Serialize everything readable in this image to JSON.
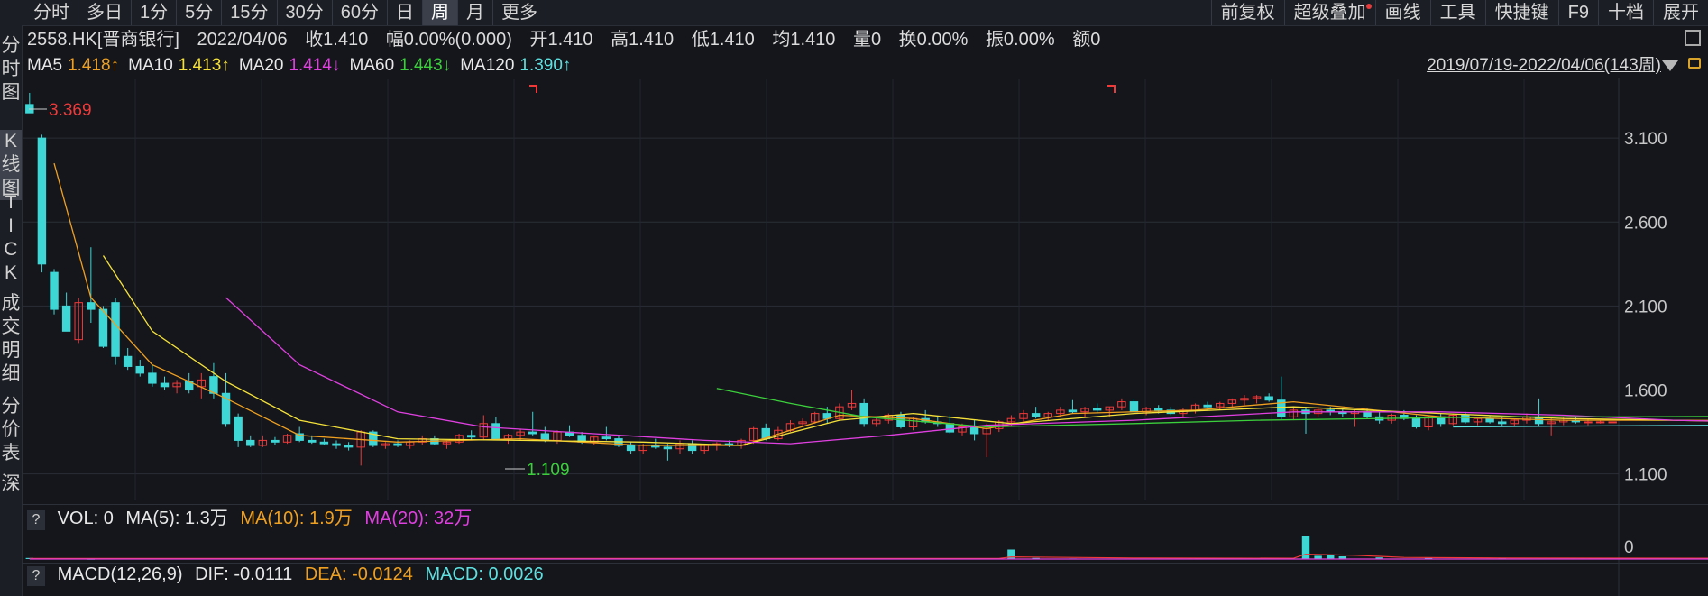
{
  "toolbar": {
    "tabs": [
      "分时",
      "多日",
      "1分",
      "5分",
      "15分",
      "30分",
      "60分",
      "日",
      "周",
      "月",
      "更多"
    ],
    "active_tab": "周",
    "right_tools": [
      "前复权",
      "超级叠加",
      "画线",
      "工具",
      "快捷键",
      "F9",
      "十档",
      "展开"
    ]
  },
  "left_tabs": [
    {
      "label": "分时图",
      "active": false
    },
    {
      "label": "K线图",
      "active": true
    },
    {
      "label": "TICK",
      "active": false
    },
    {
      "label": "成交明细",
      "active": false
    },
    {
      "label": "分价表",
      "active": false
    },
    {
      "label": "深",
      "active": false
    }
  ],
  "info": {
    "code": "2558.HK[晋商银行]",
    "date": "2022/04/06",
    "close": "收1.410",
    "change": "幅0.00%(0.000)",
    "open": "开1.410",
    "high": "高1.410",
    "low": "低1.410",
    "avg": "均1.410",
    "volume": "量0",
    "turnover": "换0.00%",
    "amplitude": "振0.00%",
    "amount": "额0"
  },
  "ma_line": [
    {
      "name": "MA5",
      "value": "1.418↑",
      "color": "#e8e8e8",
      "vcolor": "#f0a020"
    },
    {
      "name": "MA10",
      "value": "1.413↑",
      "color": "#e8e8e8",
      "vcolor": "#f5e13a"
    },
    {
      "name": "MA20",
      "value": "1.414↓",
      "color": "#e8e8e8",
      "vcolor": "#e040e0"
    },
    {
      "name": "MA60",
      "value": "1.443↓",
      "color": "#e8e8e8",
      "vcolor": "#3ccf3c"
    },
    {
      "name": "MA120",
      "value": "1.390↑",
      "color": "#e8e8e8",
      "vcolor": "#5fe0e0"
    }
  ],
  "range_label": "2019/07/19-2022/04/06(143周)",
  "volume_panel": {
    "q": "?",
    "vol": "VOL: 0",
    "ma5": "MA(5): 1.3万",
    "ma10": "MA(10): 1.9万",
    "ma20": "MA(20): 32万",
    "axis_zero": "0"
  },
  "macd_panel": {
    "q": "?",
    "title": "MACD(12,26,9)",
    "dif": "DIF: -0.0111",
    "dea": "DEA: -0.0124",
    "macd": "MACD: 0.0026"
  },
  "colors": {
    "up": "#f03a3a",
    "down": "#3fd6d6",
    "ma5": "#f0a020",
    "ma10": "#f5e13a",
    "ma20": "#e040e0",
    "ma60": "#3ccf3c",
    "grid": "#2a2e36",
    "axis_text": "#c8c8c8"
  },
  "chart_data": {
    "type": "candlestick",
    "y_ticks": [
      3.1,
      2.6,
      2.1,
      1.6,
      1.1
    ],
    "y_tick_labels": [
      "3.100",
      "2.600",
      "2.100",
      "1.600",
      "1.100"
    ],
    "max_label": "3.369",
    "min_label": "1.109",
    "ohlc": [
      [
        3.3,
        3.369,
        3.25,
        3.25
      ],
      [
        3.1,
        3.12,
        2.3,
        2.35
      ],
      [
        2.3,
        2.32,
        2.05,
        2.08
      ],
      [
        2.1,
        2.18,
        1.95,
        1.95
      ],
      [
        1.9,
        2.15,
        1.88,
        2.12
      ],
      [
        2.12,
        2.45,
        2.0,
        2.08
      ],
      [
        2.08,
        2.1,
        1.85,
        1.86
      ],
      [
        2.12,
        2.15,
        1.75,
        1.8
      ],
      [
        1.8,
        1.85,
        1.72,
        1.74
      ],
      [
        1.74,
        1.78,
        1.68,
        1.7
      ],
      [
        1.7,
        1.75,
        1.62,
        1.64
      ],
      [
        1.64,
        1.68,
        1.6,
        1.62
      ],
      [
        1.62,
        1.66,
        1.58,
        1.64
      ],
      [
        1.65,
        1.7,
        1.58,
        1.6
      ],
      [
        1.62,
        1.7,
        1.55,
        1.66
      ],
      [
        1.68,
        1.76,
        1.55,
        1.58
      ],
      [
        1.58,
        1.7,
        1.38,
        1.4
      ],
      [
        1.44,
        1.46,
        1.26,
        1.3
      ],
      [
        1.3,
        1.33,
        1.26,
        1.27
      ],
      [
        1.27,
        1.33,
        1.26,
        1.3
      ],
      [
        1.3,
        1.32,
        1.27,
        1.29
      ],
      [
        1.29,
        1.34,
        1.28,
        1.33
      ],
      [
        1.34,
        1.38,
        1.29,
        1.3
      ],
      [
        1.3,
        1.33,
        1.28,
        1.29
      ],
      [
        1.29,
        1.31,
        1.27,
        1.28
      ],
      [
        1.28,
        1.3,
        1.25,
        1.27
      ],
      [
        1.27,
        1.29,
        1.24,
        1.26
      ],
      [
        1.26,
        1.36,
        1.15,
        1.35
      ],
      [
        1.35,
        1.36,
        1.26,
        1.27
      ],
      [
        1.27,
        1.29,
        1.25,
        1.28
      ],
      [
        1.28,
        1.3,
        1.26,
        1.27
      ],
      [
        1.27,
        1.3,
        1.25,
        1.29
      ],
      [
        1.29,
        1.33,
        1.27,
        1.31
      ],
      [
        1.31,
        1.33,
        1.27,
        1.28
      ],
      [
        1.28,
        1.3,
        1.25,
        1.29
      ],
      [
        1.29,
        1.34,
        1.28,
        1.33
      ],
      [
        1.33,
        1.36,
        1.3,
        1.32
      ],
      [
        1.32,
        1.45,
        1.3,
        1.4
      ],
      [
        1.4,
        1.44,
        1.3,
        1.31
      ],
      [
        1.31,
        1.34,
        1.28,
        1.33
      ],
      [
        1.33,
        1.37,
        1.3,
        1.35
      ],
      [
        1.35,
        1.47,
        1.33,
        1.34
      ],
      [
        1.34,
        1.38,
        1.29,
        1.3
      ],
      [
        1.3,
        1.36,
        1.28,
        1.35
      ],
      [
        1.35,
        1.39,
        1.32,
        1.33
      ],
      [
        1.33,
        1.35,
        1.28,
        1.29
      ],
      [
        1.29,
        1.33,
        1.27,
        1.32
      ],
      [
        1.32,
        1.38,
        1.3,
        1.31
      ],
      [
        1.31,
        1.33,
        1.26,
        1.27
      ],
      [
        1.27,
        1.29,
        1.22,
        1.24
      ],
      [
        1.24,
        1.28,
        1.22,
        1.27
      ],
      [
        1.27,
        1.31,
        1.25,
        1.26
      ],
      [
        1.26,
        1.28,
        1.18,
        1.25
      ],
      [
        1.25,
        1.3,
        1.22,
        1.28
      ],
      [
        1.28,
        1.3,
        1.22,
        1.24
      ],
      [
        1.24,
        1.28,
        1.22,
        1.27
      ],
      [
        1.27,
        1.29,
        1.24,
        1.28
      ],
      [
        1.28,
        1.3,
        1.26,
        1.27
      ],
      [
        1.27,
        1.31,
        1.25,
        1.3
      ],
      [
        1.3,
        1.38,
        1.28,
        1.37
      ],
      [
        1.37,
        1.4,
        1.3,
        1.31
      ],
      [
        1.31,
        1.38,
        1.3,
        1.36
      ],
      [
        1.36,
        1.42,
        1.35,
        1.4
      ],
      [
        1.4,
        1.43,
        1.38,
        1.41
      ],
      [
        1.41,
        1.47,
        1.4,
        1.46
      ],
      [
        1.46,
        1.5,
        1.4,
        1.43
      ],
      [
        1.43,
        1.52,
        1.42,
        1.5
      ],
      [
        1.5,
        1.6,
        1.48,
        1.52
      ],
      [
        1.52,
        1.55,
        1.38,
        1.4
      ],
      [
        1.4,
        1.44,
        1.38,
        1.42
      ],
      [
        1.42,
        1.46,
        1.4,
        1.45
      ],
      [
        1.45,
        1.47,
        1.37,
        1.38
      ],
      [
        1.38,
        1.44,
        1.36,
        1.43
      ],
      [
        1.43,
        1.48,
        1.4,
        1.41
      ],
      [
        1.41,
        1.44,
        1.38,
        1.4
      ],
      [
        1.4,
        1.45,
        1.34,
        1.35
      ],
      [
        1.35,
        1.4,
        1.33,
        1.38
      ],
      [
        1.38,
        1.42,
        1.3,
        1.34
      ],
      [
        1.34,
        1.4,
        1.2,
        1.37
      ],
      [
        1.37,
        1.42,
        1.35,
        1.41
      ],
      [
        1.41,
        1.45,
        1.38,
        1.43
      ],
      [
        1.43,
        1.48,
        1.41,
        1.46
      ],
      [
        1.46,
        1.5,
        1.43,
        1.44
      ],
      [
        1.44,
        1.47,
        1.42,
        1.46
      ],
      [
        1.46,
        1.5,
        1.44,
        1.48
      ],
      [
        1.48,
        1.54,
        1.46,
        1.47
      ],
      [
        1.47,
        1.5,
        1.44,
        1.49
      ],
      [
        1.49,
        1.52,
        1.46,
        1.48
      ],
      [
        1.48,
        1.5,
        1.44,
        1.5
      ],
      [
        1.5,
        1.55,
        1.48,
        1.53
      ],
      [
        1.53,
        1.55,
        1.46,
        1.47
      ],
      [
        1.47,
        1.5,
        1.45,
        1.49
      ],
      [
        1.49,
        1.51,
        1.46,
        1.48
      ],
      [
        1.48,
        1.5,
        1.45,
        1.46
      ],
      [
        1.46,
        1.49,
        1.44,
        1.48
      ],
      [
        1.48,
        1.52,
        1.46,
        1.51
      ],
      [
        1.51,
        1.53,
        1.48,
        1.5
      ],
      [
        1.5,
        1.53,
        1.48,
        1.52
      ],
      [
        1.52,
        1.55,
        1.5,
        1.54
      ],
      [
        1.54,
        1.57,
        1.51,
        1.55
      ],
      [
        1.55,
        1.57,
        1.52,
        1.56
      ],
      [
        1.56,
        1.58,
        1.53,
        1.54
      ],
      [
        1.54,
        1.68,
        1.42,
        1.44
      ],
      [
        1.44,
        1.5,
        1.42,
        1.48
      ],
      [
        1.48,
        1.5,
        1.34,
        1.46
      ],
      [
        1.46,
        1.5,
        1.44,
        1.48
      ],
      [
        1.48,
        1.5,
        1.45,
        1.47
      ],
      [
        1.47,
        1.49,
        1.44,
        1.46
      ],
      [
        1.46,
        1.48,
        1.38,
        1.47
      ],
      [
        1.47,
        1.49,
        1.43,
        1.44
      ],
      [
        1.44,
        1.47,
        1.4,
        1.42
      ],
      [
        1.42,
        1.46,
        1.4,
        1.45
      ],
      [
        1.45,
        1.48,
        1.42,
        1.43
      ],
      [
        1.43,
        1.45,
        1.37,
        1.38
      ],
      [
        1.38,
        1.45,
        1.36,
        1.44
      ],
      [
        1.44,
        1.46,
        1.38,
        1.4
      ],
      [
        1.4,
        1.46,
        1.39,
        1.45
      ],
      [
        1.45,
        1.47,
        1.4,
        1.41
      ],
      [
        1.41,
        1.44,
        1.39,
        1.43
      ],
      [
        1.43,
        1.45,
        1.4,
        1.41
      ],
      [
        1.41,
        1.44,
        1.38,
        1.4
      ],
      [
        1.4,
        1.43,
        1.38,
        1.42
      ],
      [
        1.42,
        1.46,
        1.4,
        1.44
      ],
      [
        1.44,
        1.55,
        1.38,
        1.4
      ],
      [
        1.4,
        1.44,
        1.33,
        1.41
      ],
      [
        1.41,
        1.44,
        1.39,
        1.42
      ],
      [
        1.42,
        1.44,
        1.4,
        1.41
      ],
      [
        1.41,
        1.43,
        1.39,
        1.41
      ],
      [
        1.41,
        1.42,
        1.4,
        1.41
      ],
      [
        1.41,
        1.41,
        1.41,
        1.41
      ]
    ],
    "ma_lines": {
      "MA5": [
        [
          2,
          2.95
        ],
        [
          5,
          2.15
        ],
        [
          10,
          1.75
        ],
        [
          16,
          1.55
        ],
        [
          22,
          1.33
        ],
        [
          30,
          1.29
        ],
        [
          40,
          1.31
        ],
        [
          50,
          1.27
        ],
        [
          58,
          1.27
        ],
        [
          66,
          1.45
        ],
        [
          72,
          1.43
        ],
        [
          78,
          1.37
        ],
        [
          85,
          1.46
        ],
        [
          95,
          1.48
        ],
        [
          103,
          1.53
        ],
        [
          115,
          1.44
        ],
        [
          125,
          1.42
        ],
        [
          134,
          1.42
        ],
        [
          138,
          1.418
        ]
      ],
      "MA10": [
        [
          6,
          2.4
        ],
        [
          10,
          1.95
        ],
        [
          16,
          1.65
        ],
        [
          22,
          1.42
        ],
        [
          30,
          1.31
        ],
        [
          40,
          1.3
        ],
        [
          50,
          1.29
        ],
        [
          58,
          1.27
        ],
        [
          66,
          1.42
        ],
        [
          72,
          1.46
        ],
        [
          80,
          1.4
        ],
        [
          90,
          1.46
        ],
        [
          103,
          1.5
        ],
        [
          115,
          1.46
        ],
        [
          125,
          1.43
        ],
        [
          134,
          1.42
        ],
        [
          138,
          1.413
        ]
      ],
      "MA20": [
        [
          16,
          2.15
        ],
        [
          22,
          1.75
        ],
        [
          30,
          1.47
        ],
        [
          37,
          1.38
        ],
        [
          46,
          1.34
        ],
        [
          55,
          1.3
        ],
        [
          62,
          1.28
        ],
        [
          70,
          1.33
        ],
        [
          78,
          1.39
        ],
        [
          90,
          1.42
        ],
        [
          103,
          1.47
        ],
        [
          115,
          1.47
        ],
        [
          125,
          1.45
        ],
        [
          134,
          1.42
        ],
        [
          138,
          1.414
        ]
      ],
      "MA60": [
        [
          56,
          1.61
        ],
        [
          62,
          1.52
        ],
        [
          68,
          1.44
        ],
        [
          78,
          1.38
        ],
        [
          90,
          1.4
        ],
        [
          100,
          1.42
        ],
        [
          110,
          1.43
        ],
        [
          120,
          1.44
        ],
        [
          130,
          1.44
        ],
        [
          138,
          1.443
        ]
      ],
      "MA120": [
        [
          116,
          1.38
        ],
        [
          125,
          1.385
        ],
        [
          138,
          1.39
        ]
      ]
    },
    "volume": {
      "bars": [
        [
          0,
          0.04
        ],
        [
          1,
          0.02
        ],
        [
          5,
          0.01
        ],
        [
          50,
          0.03
        ],
        [
          80,
          0.35
        ],
        [
          82,
          0.04
        ],
        [
          85,
          0.02
        ],
        [
          104,
          0.85
        ],
        [
          105,
          0.12
        ],
        [
          106,
          0.14
        ],
        [
          107,
          0.1
        ],
        [
          110,
          0.06
        ],
        [
          114,
          0.04
        ],
        [
          120,
          0.03
        ],
        [
          126,
          0.02
        ]
      ],
      "ma_line": [
        [
          0,
          0.02
        ],
        [
          79,
          0.02
        ],
        [
          80,
          0.08
        ],
        [
          90,
          0.04
        ],
        [
          103,
          0.03
        ],
        [
          104,
          0.18
        ],
        [
          108,
          0.14
        ],
        [
          112,
          0.06
        ],
        [
          120,
          0.04
        ],
        [
          138,
          0.03
        ]
      ],
      "ma20_line": [
        [
          0,
          0.0
        ],
        [
          138,
          0.0
        ]
      ]
    }
  }
}
